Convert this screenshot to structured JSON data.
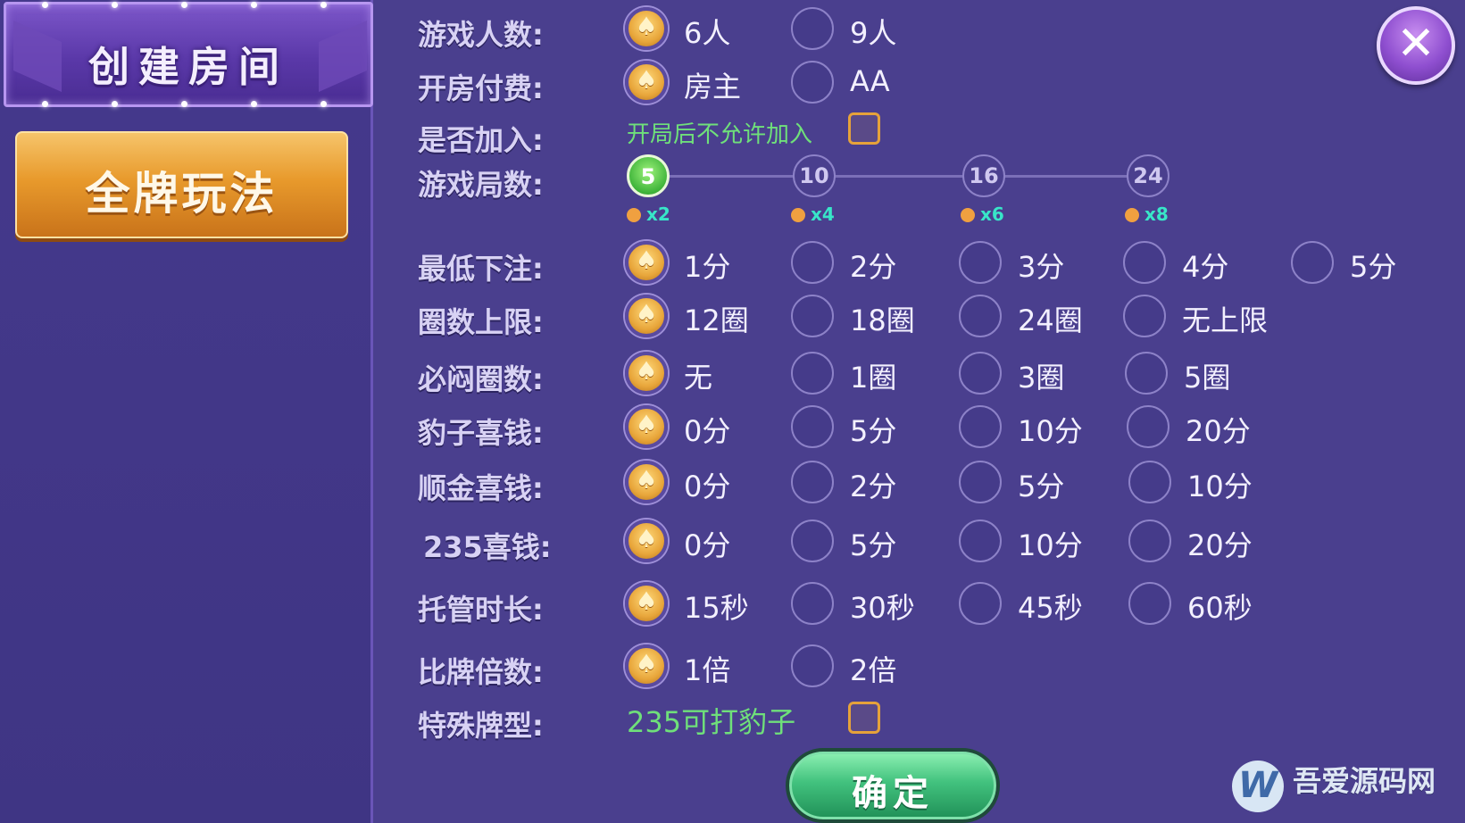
{
  "title": "创建房间",
  "mode_button": "全牌玩法",
  "close_label": "✕",
  "confirm_label": "确定",
  "rows": {
    "players": {
      "label": "游戏人数:",
      "options": [
        "6人",
        "9人"
      ],
      "selected": 0
    },
    "payment": {
      "label": "开房付费:",
      "options": [
        "房主",
        "AA"
      ],
      "selected": 0
    },
    "join": {
      "label": "是否加入:",
      "text": "开局后不允许加入"
    },
    "rounds": {
      "label": "游戏局数:",
      "nodes": [
        "5",
        "10",
        "16",
        "24"
      ],
      "multipliers": [
        "x2",
        "x4",
        "x6",
        "x8"
      ],
      "selected": 0
    },
    "min_bet": {
      "label": "最低下注:",
      "options": [
        "1分",
        "2分",
        "3分",
        "4分",
        "5分"
      ],
      "selected": 0
    },
    "circle_limit": {
      "label": "圈数上限:",
      "options": [
        "12圈",
        "18圈",
        "24圈",
        "无上限"
      ],
      "selected": 0
    },
    "must_blind": {
      "label": "必闷圈数:",
      "options": [
        "无",
        "1圈",
        "3圈",
        "5圈"
      ],
      "selected": 0
    },
    "leopard_bonus": {
      "label": "豹子喜钱:",
      "options": [
        "0分",
        "5分",
        "10分",
        "20分"
      ],
      "selected": 0
    },
    "straight_flush_bonus": {
      "label": "顺金喜钱:",
      "options": [
        "0分",
        "2分",
        "5分",
        "10分"
      ],
      "selected": 0
    },
    "bonus_235": {
      "label": "235喜钱:",
      "options": [
        "0分",
        "5分",
        "10分",
        "20分"
      ],
      "selected": 0
    },
    "auto_duration": {
      "label": "托管时长:",
      "options": [
        "15秒",
        "30秒",
        "45秒",
        "60秒"
      ],
      "selected": 0
    },
    "compare_multiplier": {
      "label": "比牌倍数:",
      "options": [
        "1倍",
        "2倍"
      ],
      "selected": 0
    },
    "special": {
      "label": "特殊牌型:",
      "text": "235可打豹子"
    }
  },
  "watermark": {
    "logo": "W",
    "text": "吾爱源码网"
  }
}
